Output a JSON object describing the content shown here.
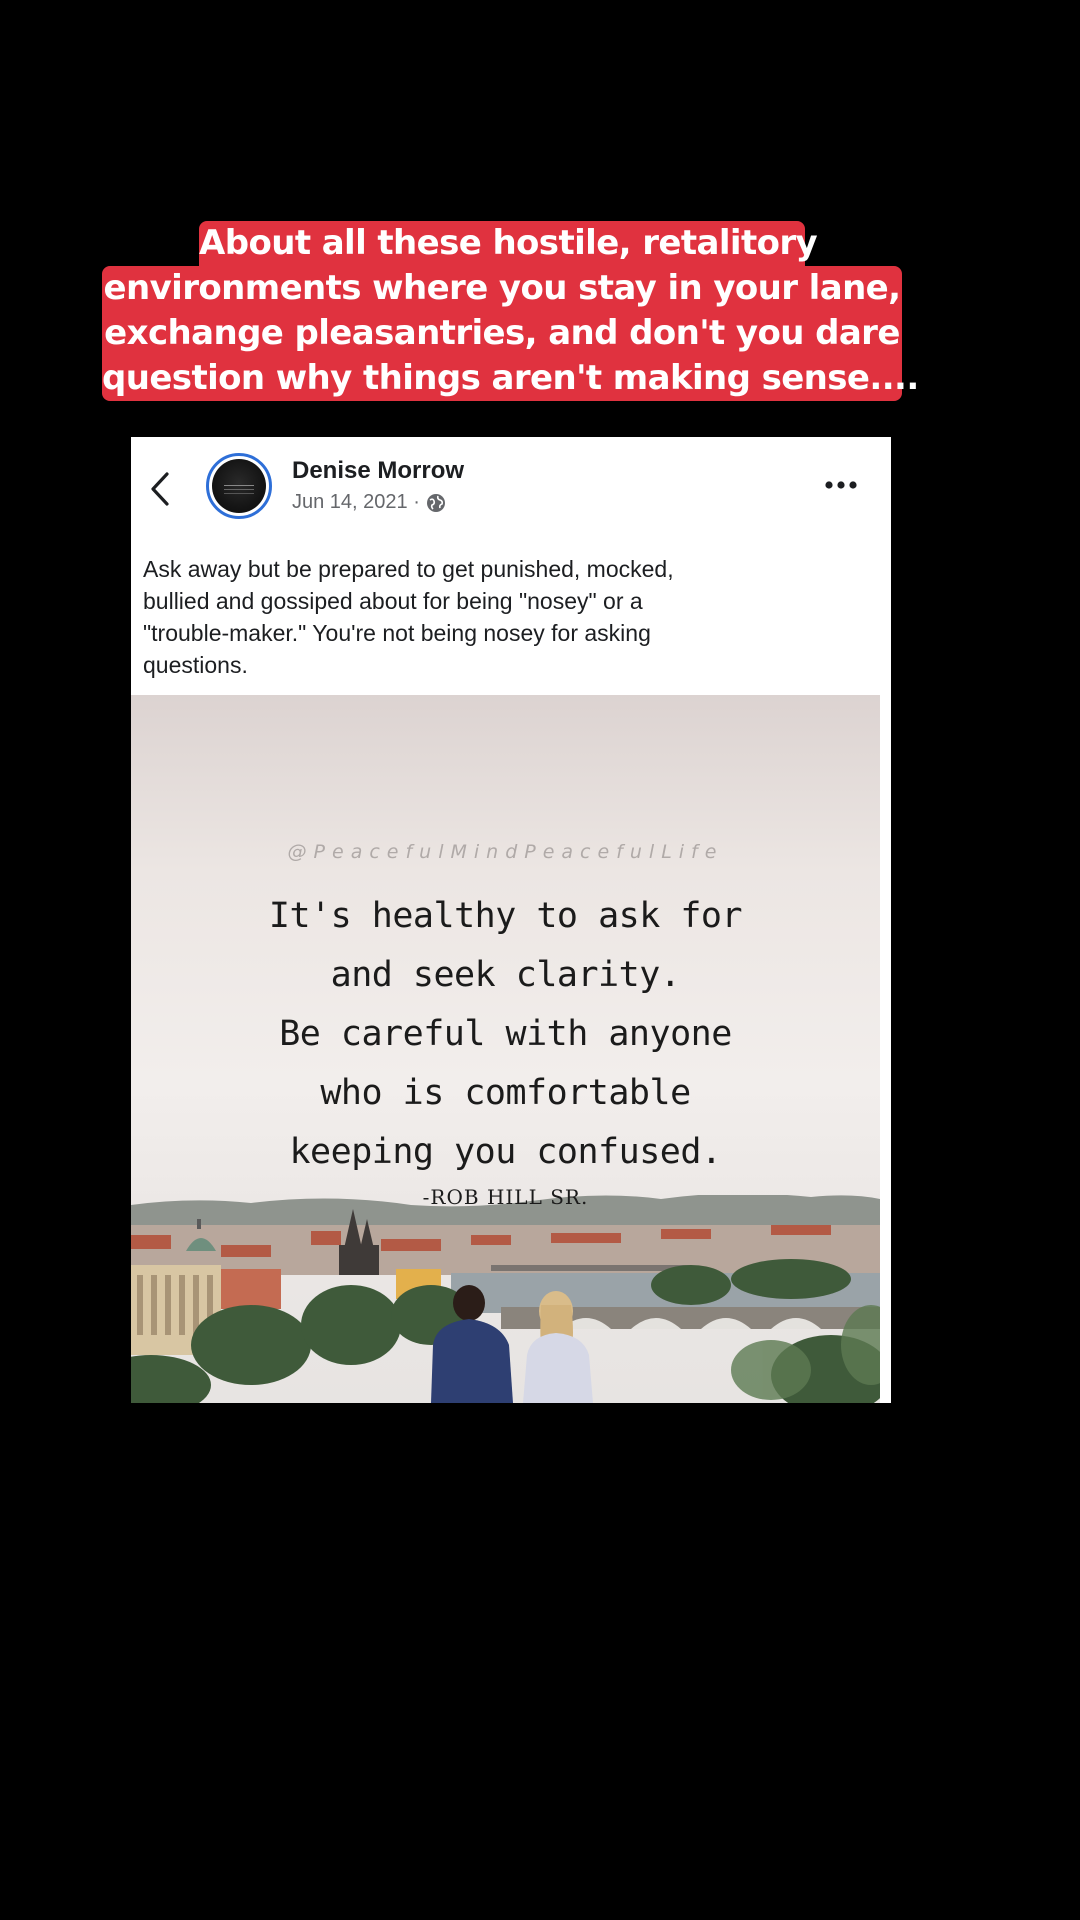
{
  "caption": {
    "lines": [
      "About all these hostile, retalitory",
      "environments where you stay in your lane,",
      "exchange pleasantries, and don't you dare",
      "question why things aren't making sense...."
    ],
    "background_color": "#e0323f"
  },
  "post": {
    "author": "Denise Morrow",
    "date": "Jun 14, 2021 ·",
    "visibility_icon": "globe-icon",
    "back_icon": "chevron-left-icon",
    "more_icon": "more-dots-icon",
    "text": "Ask away but be prepared to get punished, mocked, bullied and gossiped about for being \"nosey\" or a \"trouble-maker.\"  You're not being nosey for asking questions.",
    "text_lines": [
      "Ask away but be prepared to get punished, mocked,",
      "bullied and gossiped about for being \"nosey\" or a",
      "\"trouble-maker.\"  You're not being nosey for asking",
      "questions."
    ],
    "accent_color": "#2e6fd8"
  },
  "image": {
    "handle": "@PeacefulMindPeacefulLife",
    "quote_lines": [
      "It's healthy to ask for",
      "and seek clarity.",
      "Be careful with anyone",
      "who is comfortable",
      "keeping you confused."
    ],
    "attribution": "-ROB HILL SR."
  }
}
